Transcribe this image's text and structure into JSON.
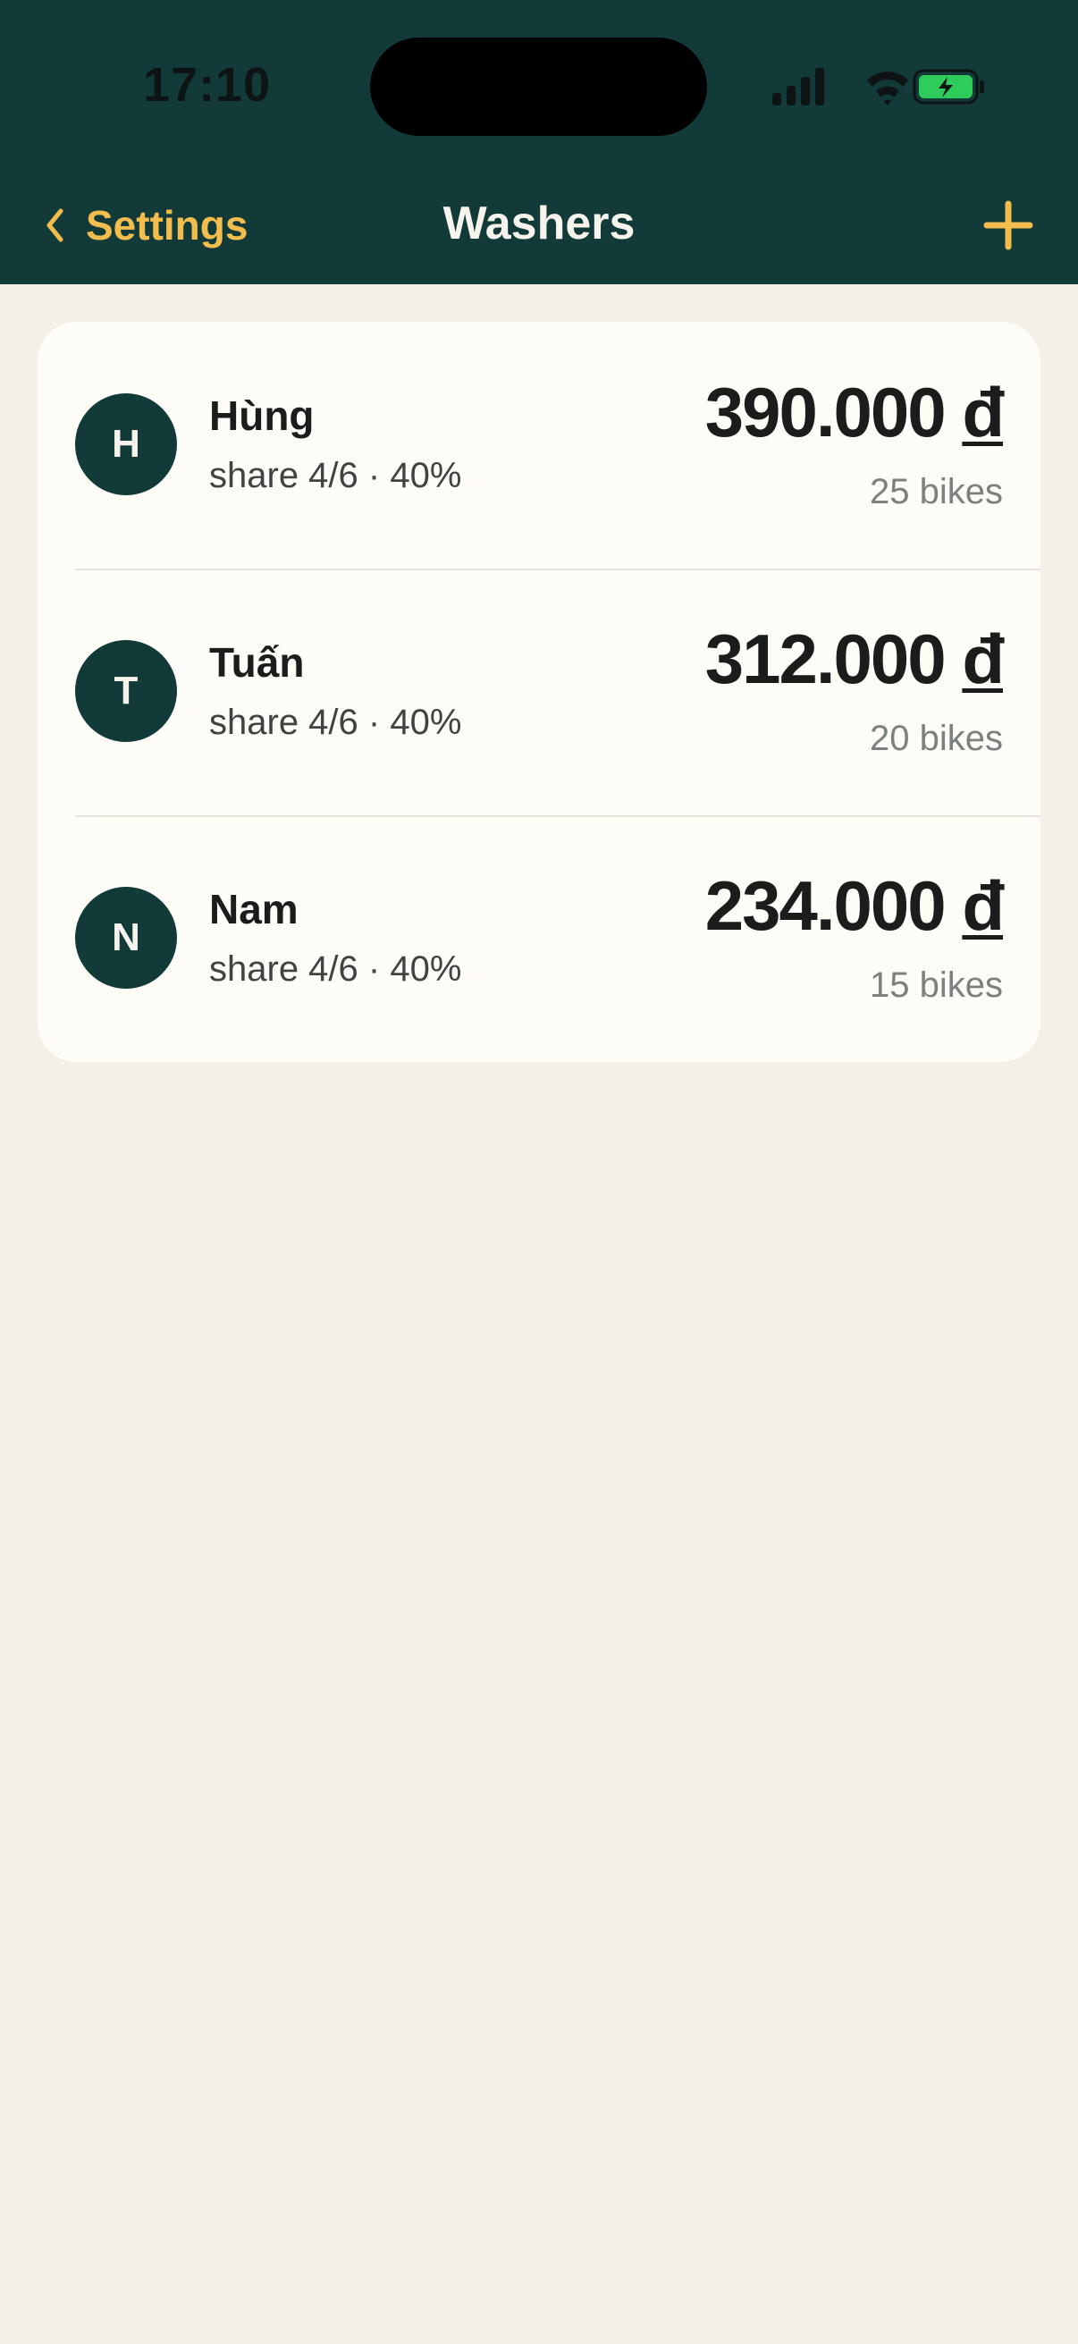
{
  "status_bar": {
    "time": "17:10"
  },
  "nav": {
    "back_label": "Settings",
    "title": "Washers",
    "add_icon": "plus-icon"
  },
  "colors": {
    "header_bg": "#113a39",
    "accent": "#f3bd4e",
    "page_bg": "#f4f0e7",
    "card_bg": "#fdfcf7",
    "battery_green": "#2ecc5a"
  },
  "washers": [
    {
      "initial": "H",
      "name": "Hùng",
      "share": "share 4/6 · 40%",
      "amount": "390.000",
      "currency": "đ",
      "bikes": "25 bikes"
    },
    {
      "initial": "T",
      "name": "Tuấn",
      "share": "share 4/6 · 40%",
      "amount": "312.000",
      "currency": "đ",
      "bikes": "20 bikes"
    },
    {
      "initial": "N",
      "name": "Nam",
      "share": "share 4/6 · 40%",
      "amount": "234.000",
      "currency": "đ",
      "bikes": "15 bikes"
    }
  ]
}
